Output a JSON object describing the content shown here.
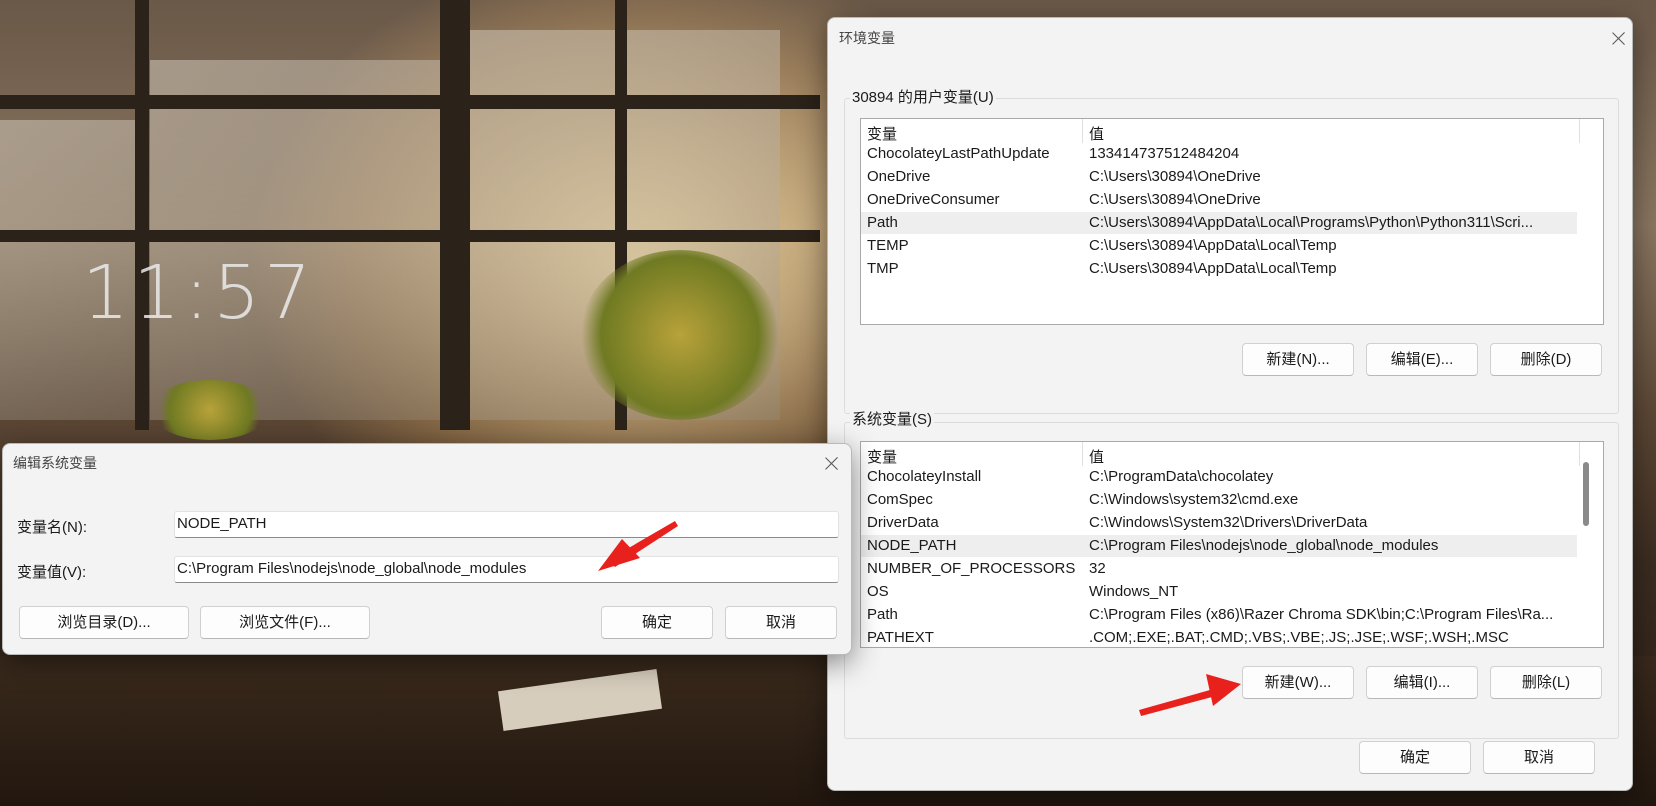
{
  "wallpaper": {
    "clock": "11:57"
  },
  "env_dialog": {
    "title": "环境变量",
    "user_vars": {
      "group_label": "30894 的用户变量(U)",
      "col_name": "变量",
      "col_value": "值",
      "rows": [
        {
          "name": "ChocolateyLastPathUpdate",
          "value": "133414737512484204"
        },
        {
          "name": "OneDrive",
          "value": "C:\\Users\\30894\\OneDrive"
        },
        {
          "name": "OneDriveConsumer",
          "value": "C:\\Users\\30894\\OneDrive"
        },
        {
          "name": "Path",
          "value": "C:\\Users\\30894\\AppData\\Local\\Programs\\Python\\Python311\\Scri..."
        },
        {
          "name": "TEMP",
          "value": "C:\\Users\\30894\\AppData\\Local\\Temp"
        },
        {
          "name": "TMP",
          "value": "C:\\Users\\30894\\AppData\\Local\\Temp"
        }
      ],
      "new_label": "新建(N)...",
      "edit_label": "编辑(E)...",
      "delete_label": "删除(D)"
    },
    "sys_vars": {
      "group_label": "系统变量(S)",
      "col_name": "变量",
      "col_value": "值",
      "rows": [
        {
          "name": "ChocolateyInstall",
          "value": "C:\\ProgramData\\chocolatey"
        },
        {
          "name": "ComSpec",
          "value": "C:\\Windows\\system32\\cmd.exe"
        },
        {
          "name": "DriverData",
          "value": "C:\\Windows\\System32\\Drivers\\DriverData"
        },
        {
          "name": "NODE_PATH",
          "value": "C:\\Program Files\\nodejs\\node_global\\node_modules"
        },
        {
          "name": "NUMBER_OF_PROCESSORS",
          "value": "32"
        },
        {
          "name": "OS",
          "value": "Windows_NT"
        },
        {
          "name": "Path",
          "value": "C:\\Program Files (x86)\\Razer Chroma SDK\\bin;C:\\Program Files\\Ra..."
        },
        {
          "name": "PATHEXT",
          "value": ".COM;.EXE;.BAT;.CMD;.VBS;.VBE;.JS;.JSE;.WSF;.WSH;.MSC"
        }
      ],
      "new_label": "新建(W)...",
      "edit_label": "编辑(I)...",
      "delete_label": "删除(L)"
    },
    "ok_label": "确定",
    "cancel_label": "取消"
  },
  "edit_dialog": {
    "title": "编辑系统变量",
    "name_label": "变量名(N):",
    "name_value": "NODE_PATH",
    "value_label": "变量值(V):",
    "value_value": "C:\\Program Files\\nodejs\\node_global\\node_modules",
    "browse_dir_label": "浏览目录(D)...",
    "browse_file_label": "浏览文件(F)...",
    "ok_label": "确定",
    "cancel_label": "取消"
  },
  "colors": {
    "annotation_arrow": "#e8211c",
    "selected_row": "#eeeeee"
  }
}
